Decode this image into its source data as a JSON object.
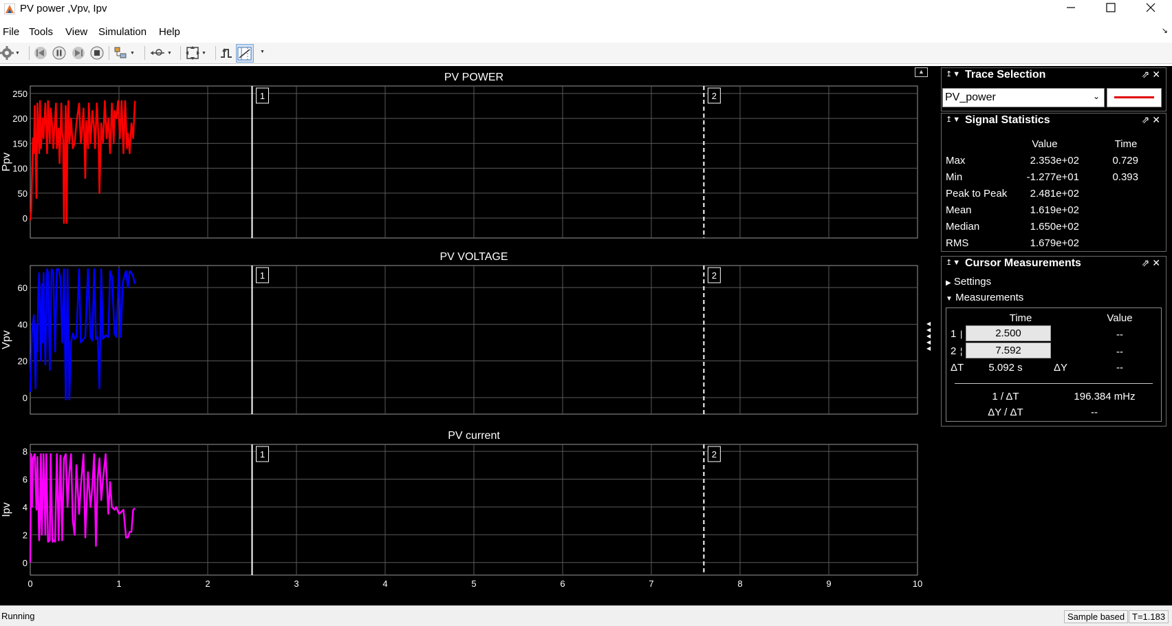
{
  "window": {
    "title": "PV power ,Vpv, Ipv"
  },
  "menu": [
    "File",
    "Tools",
    "View",
    "Simulation",
    "Help"
  ],
  "toolbar": {
    "icons": [
      "gear-icon",
      "step-back-icon",
      "pause-icon",
      "step-forward-icon",
      "stop-icon",
      "highlight-icon",
      "zoom-icon",
      "scale-axes-icon",
      "triggers-icon",
      "cursor-measurements-icon"
    ]
  },
  "colors": {
    "power": "#ff0000",
    "voltage": "#0000ff",
    "current": "#ff00ff",
    "background": "#000000",
    "grid": "#5a5a5a"
  },
  "chart_data": [
    {
      "type": "line",
      "title": "PV POWER",
      "ylabel": "Ppv",
      "ylim": [
        -40,
        265
      ],
      "yticks": [
        "0",
        "50",
        "100",
        "150",
        "200",
        "250"
      ],
      "ytick_values": [
        0,
        50,
        100,
        150,
        200,
        250
      ],
      "xlim": [
        0,
        10
      ],
      "series": [
        {
          "color": "#ff0000",
          "x": [
            0.0,
            0.01,
            0.03,
            0.04,
            0.05,
            0.06,
            0.07,
            0.08,
            0.09,
            0.1,
            0.11,
            0.12,
            0.14,
            0.15,
            0.17,
            0.19,
            0.2,
            0.22,
            0.23,
            0.25,
            0.26,
            0.28,
            0.29,
            0.3,
            0.32,
            0.33,
            0.35,
            0.36,
            0.37,
            0.38,
            0.39,
            0.4,
            0.41,
            0.42,
            0.43,
            0.44,
            0.45,
            0.46,
            0.48,
            0.5,
            0.52,
            0.55,
            0.57,
            0.58,
            0.6,
            0.62,
            0.63,
            0.65,
            0.66,
            0.68,
            0.7,
            0.72,
            0.73,
            0.75,
            0.77,
            0.78,
            0.8,
            0.82,
            0.84,
            0.86,
            0.88,
            0.9,
            0.92,
            0.94,
            0.95,
            0.97,
            0.99,
            1.0,
            1.01,
            1.02,
            1.03,
            1.05,
            1.06,
            1.07,
            1.09,
            1.1,
            1.12,
            1.14,
            1.16,
            1.18
          ],
          "y": [
            -5,
            15,
            160,
            130,
            225,
            140,
            40,
            230,
            180,
            130,
            235,
            140,
            200,
            160,
            230,
            130,
            235,
            150,
            220,
            180,
            140,
            200,
            230,
            140,
            180,
            110,
            230,
            170,
            160,
            -10,
            140,
            225,
            -10,
            190,
            235,
            150,
            170,
            200,
            140,
            150,
            190,
            230,
            150,
            165,
            220,
            80,
            195,
            140,
            230,
            150,
            215,
            180,
            140,
            230,
            160,
            50,
            190,
            150,
            235,
            160,
            200,
            130,
            230,
            150,
            215,
            200,
            235,
            195,
            160,
            200,
            235,
            130,
            180,
            235,
            140,
            170,
            130,
            190,
            160,
            235
          ]
        }
      ],
      "cursors": [
        2.5,
        7.592
      ]
    },
    {
      "type": "line",
      "title": "PV VOLTAGE",
      "ylabel": "Vpv",
      "ylim": [
        -9,
        72
      ],
      "yticks": [
        "0",
        "20",
        "40",
        "60"
      ],
      "ytick_values": [
        0,
        20,
        40,
        60
      ],
      "xlim": [
        0,
        10
      ],
      "series": [
        {
          "color": "#0000ff",
          "x": [
            0.0,
            0.01,
            0.02,
            0.04,
            0.06,
            0.07,
            0.08,
            0.09,
            0.1,
            0.12,
            0.13,
            0.14,
            0.15,
            0.17,
            0.19,
            0.2,
            0.22,
            0.24,
            0.26,
            0.28,
            0.3,
            0.32,
            0.34,
            0.36,
            0.38,
            0.4,
            0.42,
            0.44,
            0.46,
            0.48,
            0.5,
            0.52,
            0.55,
            0.57,
            0.6,
            0.62,
            0.65,
            0.68,
            0.7,
            0.72,
            0.74,
            0.76,
            0.78,
            0.8,
            0.82,
            0.85,
            0.88,
            0.9,
            0.92,
            0.95,
            0.97,
            1.0,
            1.02,
            1.04,
            1.06,
            1.08,
            1.1,
            1.12,
            1.14,
            1.16,
            1.18
          ],
          "y": [
            3,
            20,
            36,
            45,
            5,
            40,
            25,
            58,
            68,
            20,
            62,
            30,
            68,
            18,
            70,
            68,
            15,
            70,
            68,
            25,
            70,
            70,
            65,
            30,
            70,
            -1,
            70,
            -1,
            30,
            35,
            32,
            33,
            70,
            30,
            32,
            33,
            70,
            33,
            31,
            70,
            32,
            33,
            5,
            70,
            32,
            34,
            33,
            69,
            66,
            35,
            33,
            70,
            33,
            62,
            66,
            69,
            60,
            69,
            68,
            66,
            62
          ]
        }
      ],
      "cursors": [
        2.5,
        7.592
      ]
    },
    {
      "type": "line",
      "title": "PV current",
      "ylabel": "Ipv",
      "ylim": [
        -0.9,
        8.5
      ],
      "yticks": [
        "0",
        "2",
        "4",
        "6",
        "8"
      ],
      "ytick_values": [
        0,
        2,
        4,
        6,
        8
      ],
      "xlim": [
        0,
        10
      ],
      "series": [
        {
          "color": "#ff00ff",
          "x": [
            0.0,
            0.01,
            0.02,
            0.03,
            0.05,
            0.07,
            0.08,
            0.1,
            0.11,
            0.12,
            0.13,
            0.15,
            0.17,
            0.18,
            0.2,
            0.22,
            0.23,
            0.25,
            0.27,
            0.28,
            0.3,
            0.32,
            0.34,
            0.36,
            0.38,
            0.4,
            0.42,
            0.44,
            0.46,
            0.48,
            0.5,
            0.52,
            0.55,
            0.57,
            0.6,
            0.62,
            0.65,
            0.68,
            0.7,
            0.72,
            0.74,
            0.76,
            0.78,
            0.8,
            0.82,
            0.85,
            0.88,
            0.9,
            0.92,
            0.95,
            0.97,
            1.0,
            1.02,
            1.05,
            1.08,
            1.1,
            1.12,
            1.14,
            1.16,
            1.18
          ],
          "y": [
            0.0,
            7.8,
            4.0,
            7.5,
            7.8,
            3.8,
            7.6,
            1.6,
            3.5,
            7.8,
            2.0,
            7.8,
            2.0,
            7.8,
            1.5,
            1.6,
            7.8,
            1.5,
            1.6,
            1.5,
            7.8,
            1.6,
            7.7,
            1.6,
            7.5,
            7.8,
            4.0,
            6.5,
            7.8,
            3.0,
            2.0,
            7.0,
            3.5,
            5.5,
            7.8,
            1.8,
            6.5,
            4.0,
            5.5,
            7.8,
            1.2,
            6.0,
            7.5,
            4.5,
            6.0,
            7.8,
            3.5,
            5.8,
            4.0,
            3.8,
            4.0,
            3.5,
            3.6,
            3.8,
            1.8,
            1.8,
            2.2,
            2.2,
            3.8,
            3.9
          ]
        }
      ],
      "cursors": [
        2.5,
        7.592
      ]
    }
  ],
  "xticks": [
    "0",
    "1",
    "2",
    "3",
    "4",
    "5",
    "6",
    "7",
    "8",
    "9",
    "10"
  ],
  "cursor_labels": [
    "1",
    "2"
  ],
  "trace_selection": {
    "title": "Trace Selection",
    "signal": "PV_power"
  },
  "signal_statistics": {
    "title": "Signal Statistics",
    "col_value": "Value",
    "col_time": "Time",
    "rows": [
      {
        "label": "Max",
        "value": "2.353e+02",
        "time": "0.729"
      },
      {
        "label": "Min",
        "value": "-1.277e+01",
        "time": "0.393"
      },
      {
        "label": "Peak to Peak",
        "value": "2.481e+02",
        "time": ""
      },
      {
        "label": "Mean",
        "value": "1.619e+02",
        "time": ""
      },
      {
        "label": "Median",
        "value": "1.650e+02",
        "time": ""
      },
      {
        "label": "RMS",
        "value": "1.679e+02",
        "time": ""
      }
    ]
  },
  "cursor_measurements": {
    "title": "Cursor Measurements",
    "settings": "Settings",
    "measurements": "Measurements",
    "col_time": "Time",
    "col_value": "Value",
    "c1_label": "1",
    "c1_time": "2.500",
    "c1_value": "--",
    "c2_label": "2",
    "c2_time": "7.592",
    "c2_value": "--",
    "dt_label": "ΔT",
    "dt_value": "5.092 s",
    "dy_label": "ΔY",
    "dy_value": "--",
    "inv_dt_label": "1 / ΔT",
    "inv_dt_value": "196.384 mHz",
    "dydt_label": "ΔY / ΔT",
    "dydt_value": "--"
  },
  "status": {
    "state": "Running",
    "mode": "Sample based",
    "time": "T=1.183"
  }
}
